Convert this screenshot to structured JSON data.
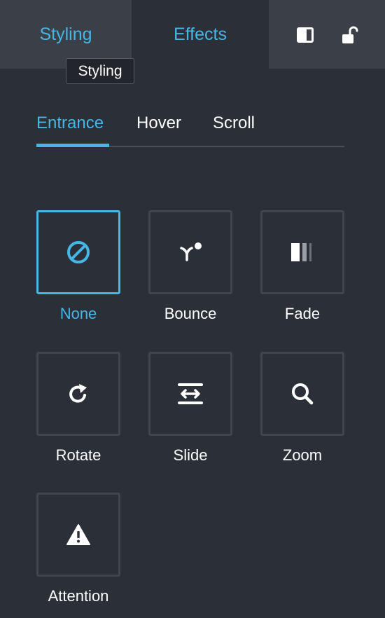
{
  "header": {
    "tabs": [
      {
        "label": "Styling"
      },
      {
        "label": "Effects"
      }
    ],
    "tooltip": "Styling"
  },
  "effects": {
    "subtabs": [
      {
        "label": "Entrance"
      },
      {
        "label": "Hover"
      },
      {
        "label": "Scroll"
      }
    ],
    "options": [
      {
        "label": "None",
        "icon": "none-icon"
      },
      {
        "label": "Bounce",
        "icon": "bounce-icon"
      },
      {
        "label": "Fade",
        "icon": "fade-icon"
      },
      {
        "label": "Rotate",
        "icon": "rotate-icon"
      },
      {
        "label": "Slide",
        "icon": "slide-icon"
      },
      {
        "label": "Zoom",
        "icon": "zoom-icon"
      },
      {
        "label": "Attention",
        "icon": "attention-icon"
      }
    ],
    "selected": "None"
  },
  "colors": {
    "accent": "#45b6e6",
    "background": "#2b2f38",
    "header": "#3a3f48",
    "tile_border": "#40454e"
  }
}
